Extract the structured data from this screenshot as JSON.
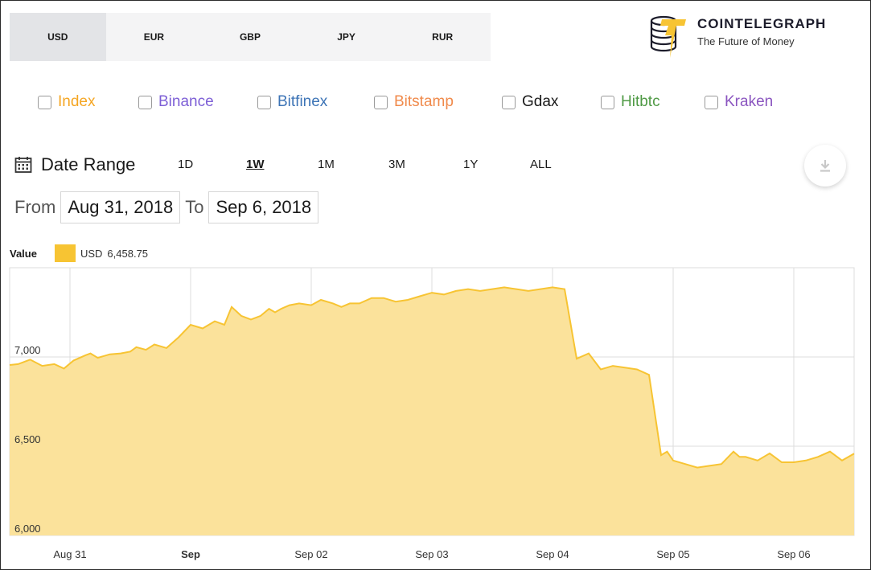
{
  "currencies": {
    "items": [
      {
        "label": "USD",
        "active": true
      },
      {
        "label": "EUR",
        "active": false
      },
      {
        "label": "GBP",
        "active": false
      },
      {
        "label": "JPY",
        "active": false
      },
      {
        "label": "RUR",
        "active": false
      }
    ]
  },
  "brand": {
    "name": "COINTELEGRAPH",
    "tagline": "The Future of Money"
  },
  "exchanges": [
    {
      "label": "Index",
      "checked": true,
      "color": "#f5a623"
    },
    {
      "label": "Binance",
      "checked": false,
      "color": "#7d5fd6"
    },
    {
      "label": "Bitfinex",
      "checked": false,
      "color": "#3d74b6"
    },
    {
      "label": "Bitstamp",
      "checked": false,
      "color": "#f08a4b"
    },
    {
      "label": "Gdax",
      "checked": false,
      "color": "#1a1a1a"
    },
    {
      "label": "Hitbtc",
      "checked": false,
      "color": "#4f9a45"
    },
    {
      "label": "Kraken",
      "checked": false,
      "color": "#8b56c0"
    }
  ],
  "date_range": {
    "label": "Date Range",
    "ranges": [
      {
        "label": "1D",
        "active": false
      },
      {
        "label": "1W",
        "active": true
      },
      {
        "label": "1M",
        "active": false
      },
      {
        "label": "3M",
        "active": false
      },
      {
        "label": "1Y",
        "active": false
      },
      {
        "label": "ALL",
        "active": false
      }
    ],
    "from_label": "From",
    "from_value": "Aug 31, 2018",
    "to_label": "To",
    "to_value": "Sep 6, 2018"
  },
  "legend": {
    "title": "Value",
    "series": "USD",
    "value": "6,458.75",
    "color": "#f7c433"
  },
  "colors": {
    "area_fill": "#fbe29b",
    "line": "#f7c433",
    "grid": "#dcdcdc",
    "checkbox": "#2f8bea"
  },
  "chart_data": {
    "type": "area",
    "ylim": [
      6000,
      7500
    ],
    "y_ticks": [
      7000,
      6500,
      6000
    ],
    "y_tick_labels": [
      "7,000",
      "6,500",
      "6,000"
    ],
    "x_ticks": [
      0,
      1,
      2,
      3,
      4,
      5,
      6
    ],
    "x_tick_labels": [
      "Aug 31",
      "Sep",
      "Sep 02",
      "Sep 03",
      "Sep 04",
      "Sep 05",
      "Sep 06"
    ],
    "x_tick_bold": [
      false,
      true,
      false,
      false,
      false,
      false,
      false
    ],
    "xlim": [
      -0.5,
      6.5
    ],
    "grid": true,
    "series": [
      {
        "name": "USD",
        "x": [
          -0.5,
          -0.43,
          -0.33,
          -0.23,
          -0.13,
          -0.05,
          0.03,
          0.13,
          0.17,
          0.23,
          0.33,
          0.42,
          0.5,
          0.55,
          0.63,
          0.7,
          0.8,
          0.9,
          1.0,
          1.1,
          1.2,
          1.28,
          1.34,
          1.42,
          1.5,
          1.58,
          1.65,
          1.7,
          1.75,
          1.82,
          1.9,
          2.0,
          2.08,
          2.18,
          2.25,
          2.32,
          2.4,
          2.5,
          2.6,
          2.7,
          2.8,
          2.9,
          3.0,
          3.1,
          3.2,
          3.3,
          3.4,
          3.5,
          3.6,
          3.7,
          3.8,
          3.9,
          4.0,
          4.1,
          4.2,
          4.3,
          4.4,
          4.5,
          4.6,
          4.7,
          4.8,
          4.9,
          4.95,
          5.0,
          5.1,
          5.2,
          5.3,
          5.4,
          5.5,
          5.55,
          5.6,
          5.7,
          5.8,
          5.9,
          6.0,
          6.1,
          6.2,
          6.3,
          6.4,
          6.5
        ],
        "y": [
          6955,
          6960,
          6985,
          6950,
          6960,
          6935,
          6980,
          7010,
          7020,
          6995,
          7015,
          7020,
          7030,
          7055,
          7040,
          7070,
          7050,
          7110,
          7180,
          7160,
          7200,
          7180,
          7280,
          7230,
          7210,
          7230,
          7270,
          7250,
          7270,
          7290,
          7300,
          7290,
          7320,
          7300,
          7280,
          7300,
          7300,
          7330,
          7330,
          7310,
          7320,
          7340,
          7360,
          7350,
          7370,
          7380,
          7370,
          7380,
          7390,
          7380,
          7370,
          7380,
          7390,
          7380,
          6990,
          7020,
          6930,
          6950,
          6940,
          6930,
          6900,
          6450,
          6470,
          6420,
          6400,
          6380,
          6390,
          6400,
          6470,
          6440,
          6440,
          6420,
          6460,
          6410,
          6410,
          6420,
          6440,
          6470,
          6420,
          6458
        ]
      }
    ]
  }
}
